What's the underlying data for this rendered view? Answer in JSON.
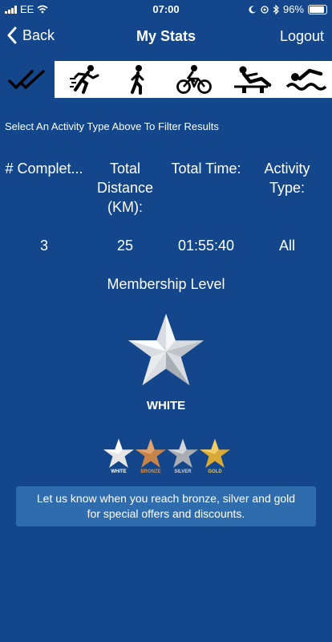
{
  "status_bar": {
    "carrier": "EE",
    "time": "07:00",
    "battery": "96%"
  },
  "nav": {
    "back_label": "Back",
    "title": "My Stats",
    "logout_label": "Logout"
  },
  "activity_tabs": [
    {
      "icon": "double-check-icon"
    },
    {
      "icon": "running-icon"
    },
    {
      "icon": "walking-icon"
    },
    {
      "icon": "cycling-icon"
    },
    {
      "icon": "rowing-icon"
    },
    {
      "icon": "swimming-icon"
    }
  ],
  "filter_hint": "Select An Activity Type Above To Filter Results",
  "stats": {
    "headers": [
      "# Complet...",
      "Total Distance (KM):",
      "Total Time:",
      "Activity Type:"
    ],
    "values": [
      "3",
      "25",
      "01:55:40",
      "All"
    ]
  },
  "membership": {
    "title": "Membership Level",
    "level": "WHITE",
    "levels": [
      "WHITE",
      "BRONZE",
      "SILVER",
      "GOLD"
    ],
    "colors": {
      "white": "#e6e6e6",
      "bronze": "#c7834a",
      "silver": "#a9adb3",
      "gold": "#d8aa35"
    }
  },
  "promo": "Let us know when you reach bronze, silver and gold for special offers and discounts."
}
